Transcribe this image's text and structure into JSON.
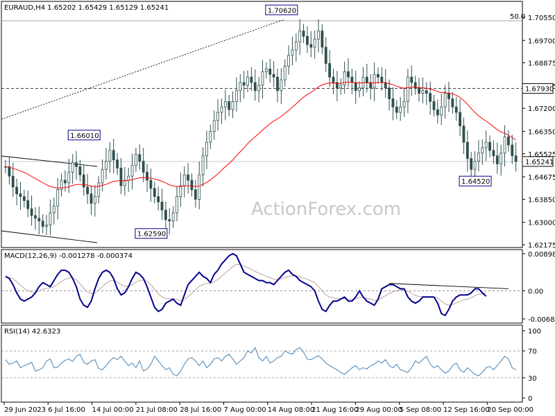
{
  "symbol_header": "EURAUD,H4  1.65202 1.65429 1.65129 1.65241",
  "watermark": "ActionForex.com",
  "price_axis_ticks": [
    "1.70550",
    "1.69700",
    "1.68875",
    "1.68025",
    "1.67200",
    "1.66350",
    "1.65525",
    "1.64675",
    "1.63850",
    "1.63000",
    "1.62175"
  ],
  "price_tick_values": [
    1.7055,
    1.697,
    1.68875,
    1.68025,
    1.672,
    1.6635,
    1.65525,
    1.64675,
    1.6385,
    1.63,
    1.62175
  ],
  "current_price_label": "1.65241",
  "level_label": "1.67930",
  "fib_label": "50.0",
  "annotations": [
    {
      "text": "1.70620",
      "price": 1.7062,
      "bar": 78
    },
    {
      "text": "1.66010",
      "price": 1.6601,
      "bar": 25
    },
    {
      "text": "1.62590",
      "price": 1.6259,
      "bar": 43
    },
    {
      "text": "1.64520",
      "price": 1.6452,
      "bar": 130
    }
  ],
  "macd": {
    "title": "MACD(12,26,9) -0.001278 -0.000374",
    "ticks": [
      "0.008986",
      "0.00",
      "-0.006816"
    ],
    "tick_values": [
      0.008986,
      0.0,
      -0.006816
    ]
  },
  "rsi": {
    "title": "RSI(14) 42.6323",
    "ticks": [
      "100",
      "70",
      "30",
      "0"
    ],
    "tick_values": [
      100,
      70,
      30,
      0
    ]
  },
  "time_axis_labels": [
    "29 Jun 2023",
    "6 Jul 16:00",
    "14 Jul 00:00",
    "21 Jul 08:00",
    "28 Jul 16:00",
    "7 Aug 00:00",
    "14 Aug 08:00",
    "21 Aug 16:00",
    "29 Aug 00:00",
    "5 Sep 08:00",
    "12 Sep 16:00",
    "20 Sep 00:00"
  ],
  "colors": {
    "candle": "#2f4f4f",
    "ma": "#ff0000",
    "macd_main": "#00008b",
    "macd_signal": "#c0a0a0",
    "rsi": "#4682b4",
    "grid_dash": "#000000",
    "border": "#000000"
  },
  "chart_data": {
    "type": "line",
    "series": [
      {
        "name": "EURAUD,H4",
        "values": [
          1.6505,
          1.647,
          1.643,
          1.6405,
          1.6395,
          1.638,
          1.635,
          1.6325,
          1.6315,
          1.6305,
          1.6285,
          1.629,
          1.6335,
          1.636,
          1.642,
          1.6455,
          1.6445,
          1.6485,
          1.652,
          1.6505,
          1.6475,
          1.643,
          1.6405,
          1.637,
          1.6395,
          1.6445,
          1.6495,
          1.6525,
          1.6565,
          1.653,
          1.65,
          1.6435,
          1.6455,
          1.647,
          1.651,
          1.655,
          1.6525,
          1.6485,
          1.6455,
          1.6425,
          1.6395,
          1.6375,
          1.6345,
          1.631,
          1.6305,
          1.6335,
          1.6395,
          1.6435,
          1.6475,
          1.6455,
          1.642,
          1.6385,
          1.6475,
          1.6545,
          1.6595,
          1.6635,
          1.6675,
          1.6705,
          1.6725,
          1.6745,
          1.6715,
          1.6745,
          1.6785,
          1.6815,
          1.6805,
          1.6835,
          1.6815,
          1.6785,
          1.6805,
          1.6855,
          1.6865,
          1.6845,
          1.6835,
          1.6785,
          1.6825,
          1.6875,
          1.6915,
          1.6935,
          1.6965,
          1.7005,
          1.6985,
          1.6955,
          1.6945,
          1.6975,
          1.7005,
          1.6945,
          1.6885,
          1.6835,
          1.6815,
          1.6795,
          1.6805,
          1.6855,
          1.6835,
          1.6815,
          1.6785,
          1.6795,
          1.6835,
          1.6815,
          1.6795,
          1.6845,
          1.6835,
          1.6815,
          1.6795,
          1.6755,
          1.6725,
          1.6705,
          1.6725,
          1.6745,
          1.6835,
          1.6815,
          1.6795,
          1.6775,
          1.6785,
          1.6775,
          1.6745,
          1.6715,
          1.6695,
          1.6725,
          1.6775,
          1.6755,
          1.6725,
          1.6705,
          1.6655,
          1.6595,
          1.6535,
          1.6495,
          1.6525,
          1.6555,
          1.6575,
          1.6595,
          1.6565,
          1.6545,
          1.6515,
          1.6555,
          1.6615,
          1.6585,
          1.6545,
          1.6524
        ]
      },
      {
        "name": "MA",
        "values": [
          1.6505,
          1.6503,
          1.6499,
          1.6494,
          1.6489,
          1.6484,
          1.6477,
          1.6469,
          1.6461,
          1.6454,
          1.6446,
          1.6438,
          1.6432,
          1.6428,
          1.6426,
          1.6427,
          1.6428,
          1.6431,
          1.6436,
          1.6439,
          1.644,
          1.6439,
          1.6437,
          1.6433,
          1.6431,
          1.6433,
          1.6436,
          1.644,
          1.6446,
          1.645,
          1.6453,
          1.6453,
          1.6453,
          1.6454,
          1.6457,
          1.6461,
          1.6464,
          1.6465,
          1.6464,
          1.6463,
          1.646,
          1.6456,
          1.6451,
          1.6445,
          1.6438,
          1.6434,
          1.6432,
          1.6432,
          1.6434,
          1.6435,
          1.6434,
          1.6432,
          1.6434,
          1.644,
          1.6447,
          1.6456,
          1.6467,
          1.6479,
          1.6492,
          1.6505,
          1.6517,
          1.653,
          1.6545,
          1.656,
          1.6574,
          1.659,
          1.6603,
          1.6615,
          1.6627,
          1.664,
          1.6652,
          1.6663,
          1.6673,
          1.6681,
          1.669,
          1.6701,
          1.6712,
          1.6724,
          1.6736,
          1.6749,
          1.6761,
          1.6771,
          1.6779,
          1.6788,
          1.6799,
          1.6806,
          1.6811,
          1.6813,
          1.6813,
          1.6812,
          1.6812,
          1.6815,
          1.6816,
          1.6816,
          1.6814,
          1.6813,
          1.6814,
          1.6814,
          1.6813,
          1.6814,
          1.6815,
          1.6815,
          1.6814,
          1.6811,
          1.6807,
          1.6801,
          1.6797,
          1.6794,
          1.6796,
          1.6798,
          1.6798,
          1.6796,
          1.6795,
          1.6794,
          1.6791,
          1.6787,
          1.6781,
          1.6778,
          1.6778,
          1.6776,
          1.6773,
          1.6768,
          1.676,
          1.6748,
          1.6735,
          1.6719,
          1.6705,
          1.6692,
          1.6682,
          1.6673,
          1.6663,
          1.6652,
          1.6641,
          1.6633,
          1.6628,
          1.6621,
          1.6612,
          1.6603
        ]
      }
    ],
    "macd_main": [
      0.0035,
      0.003,
      0.0015,
      -0.0005,
      -0.002,
      -0.0025,
      -0.002,
      -0.0015,
      -0.0005,
      0.001,
      0.002,
      0.0015,
      0.001,
      0.0025,
      0.004,
      0.005,
      0.005,
      0.0045,
      0.003,
      0.001,
      -0.002,
      -0.0035,
      -0.004,
      -0.0025,
      0.0005,
      0.003,
      0.0045,
      0.005,
      0.0045,
      0.003,
      0.0005,
      -0.001,
      -0.0005,
      0.001,
      0.003,
      0.0045,
      0.004,
      0.003,
      0.001,
      -0.0015,
      -0.004,
      -0.005,
      -0.0045,
      -0.003,
      -0.0025,
      -0.002,
      -0.003,
      -0.0035,
      -0.001,
      0.0015,
      0.0025,
      0.0035,
      0.0045,
      0.0035,
      0.003,
      0.002,
      0.004,
      0.005,
      0.0065,
      0.0075,
      0.0085,
      0.009,
      0.0085,
      0.0065,
      0.0045,
      0.004,
      0.0035,
      0.003,
      0.0025,
      0.0025,
      0.002,
      0.002,
      0.0015,
      0.0025,
      0.0035,
      0.0045,
      0.005,
      0.004,
      0.0035,
      0.0025,
      0.002,
      0.0015,
      0.001,
      0.0,
      -0.0025,
      -0.0045,
      -0.005,
      -0.0035,
      -0.0025,
      -0.0025,
      -0.002,
      -0.0015,
      -0.0025,
      -0.0025,
      -0.0015,
      0.0,
      -0.0015,
      -0.0025,
      -0.003,
      -0.0035,
      -0.002,
      0.0005,
      0.001,
      0.0015,
      0.0015,
      0.001,
      0.0005,
      0.0005,
      -0.0015,
      -0.0025,
      -0.003,
      -0.0025,
      -0.0015,
      -0.0015,
      -0.0015,
      -0.0015,
      -0.003,
      -0.0055,
      -0.006,
      -0.0045,
      -0.0025,
      -0.0015,
      -0.001,
      -0.001,
      -0.001,
      -0.0005,
      0.0005,
      0.0005,
      -0.0005,
      -0.0013
    ],
    "macd_signal": [
      0.0033,
      0.0032,
      0.0029,
      0.0022,
      0.0014,
      0.0006,
      0.0,
      -0.0003,
      -0.0004,
      -0.0,
      0.0004,
      0.0006,
      0.0007,
      0.001,
      0.0016,
      0.0023,
      0.0028,
      0.0031,
      0.0031,
      0.0027,
      0.0017,
      0.0006,
      -0.0003,
      -0.0007,
      -0.0005,
      0.0002,
      0.001,
      0.0018,
      0.0024,
      0.0025,
      0.0021,
      0.0015,
      0.0011,
      0.0011,
      0.0015,
      0.0021,
      0.0025,
      0.0026,
      0.0023,
      0.0015,
      0.0004,
      -0.0007,
      -0.0015,
      -0.0018,
      -0.0019,
      -0.0019,
      -0.0021,
      -0.0024,
      -0.0021,
      -0.0014,
      -0.0006,
      0.0002,
      0.0011,
      0.0015,
      0.0018,
      0.0018,
      0.0022,
      0.0028,
      0.0035,
      0.0043,
      0.0051,
      0.0059,
      0.0064,
      0.0064,
      0.006,
      0.0056,
      0.0052,
      0.0047,
      0.0043,
      0.0039,
      0.0035,
      0.0032,
      0.0028,
      0.0028,
      0.0029,
      0.0032,
      0.0035,
      0.0036,
      0.0036,
      0.0034,
      0.0031,
      0.0028,
      0.0024,
      0.0019,
      0.001,
      0.0,
      -0.001,
      -0.0015,
      -0.0017,
      -0.0019,
      -0.0019,
      -0.0018,
      -0.002,
      -0.0021,
      -0.002,
      -0.0016,
      -0.0016,
      -0.0018,
      -0.002,
      -0.0023,
      -0.0023,
      -0.0017,
      -0.0012,
      -0.0007,
      -0.0002,
      0.0001,
      0.0002,
      0.0003,
      -0.0001,
      -0.0006,
      -0.0011,
      -0.0014,
      -0.0014,
      -0.0014,
      -0.0014,
      -0.0015,
      -0.0017,
      -0.0025,
      -0.0032,
      -0.0035,
      -0.0033,
      -0.0029,
      -0.0025,
      -0.0022,
      -0.002,
      -0.0017,
      -0.0012,
      -0.0008,
      -0.0008,
      -0.0004
    ],
    "rsi": [
      57,
      50,
      52,
      55,
      45,
      48,
      50,
      53,
      40,
      42,
      45,
      55,
      58,
      45,
      46,
      52,
      56,
      58,
      54,
      62,
      65,
      53,
      50,
      55,
      57,
      44,
      42,
      48,
      55,
      60,
      57,
      62,
      55,
      48,
      52,
      45,
      55,
      40,
      43,
      50,
      62,
      55,
      48,
      42,
      45,
      35,
      33,
      40,
      50,
      58,
      60,
      55,
      48,
      55,
      45,
      50,
      58,
      60,
      55,
      62,
      65,
      58,
      50,
      55,
      60,
      70,
      67,
      75,
      60,
      55,
      62,
      52,
      55,
      60,
      62,
      70,
      67,
      65,
      72,
      75,
      68,
      58,
      57,
      60,
      63,
      58,
      52,
      48,
      45,
      42,
      38,
      35,
      40,
      45,
      48,
      42,
      45,
      43,
      48,
      50,
      55,
      52,
      57,
      48,
      45,
      50,
      42,
      40,
      38,
      45,
      55,
      52,
      57,
      62,
      50,
      45,
      48,
      42,
      37,
      40,
      48,
      52,
      42,
      38,
      45,
      40,
      35,
      33,
      38,
      45,
      47,
      42,
      48,
      55,
      62,
      58,
      45,
      42
    ]
  }
}
